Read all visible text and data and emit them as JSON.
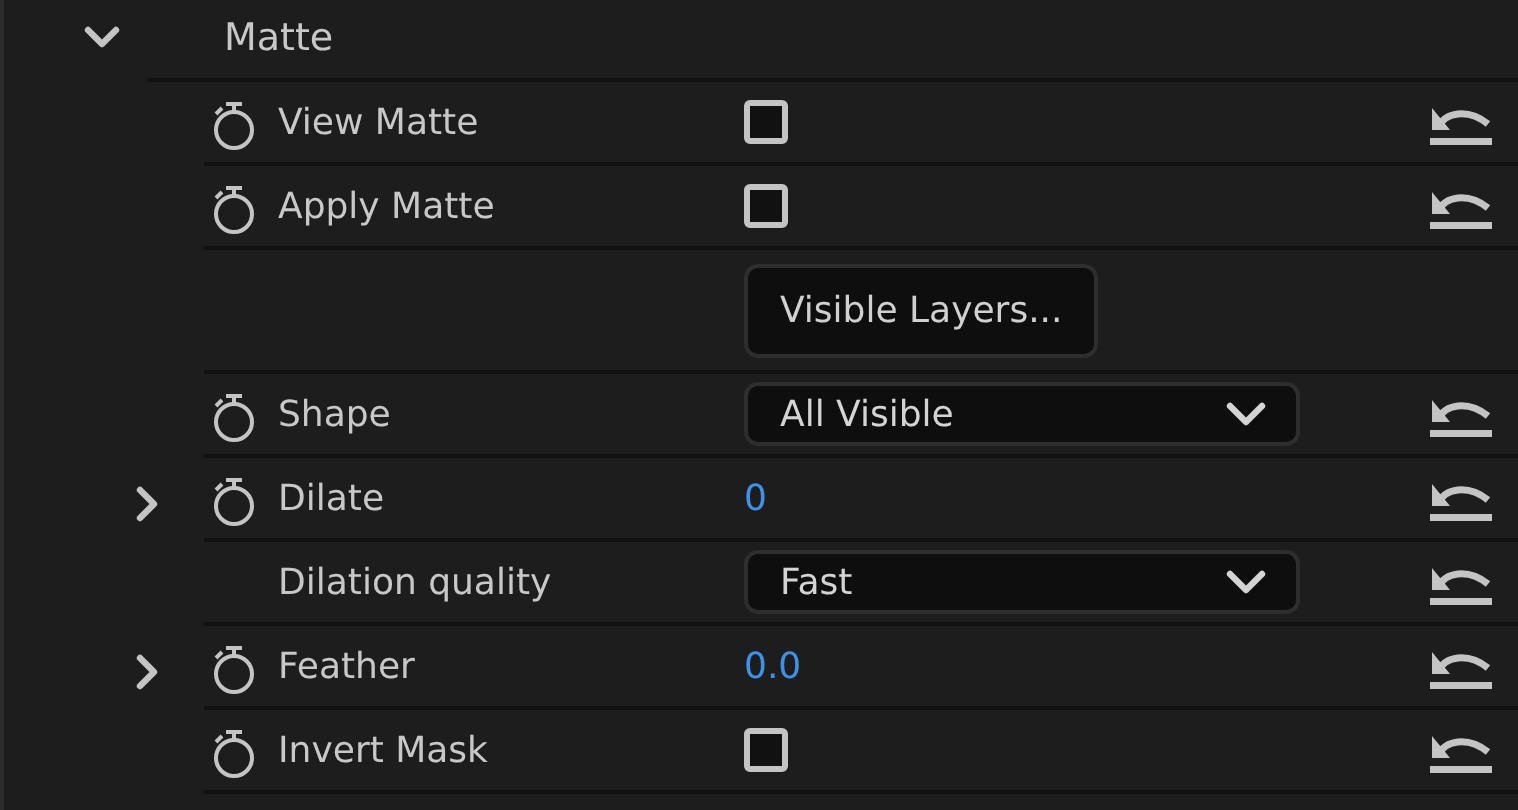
{
  "section": {
    "title": "Matte",
    "expanded": true
  },
  "rows": [
    {
      "kind": "checkbox",
      "label": "View Matte",
      "expandable": false,
      "stopwatch": true,
      "checked": false,
      "resettable": true
    },
    {
      "kind": "checkbox",
      "label": "Apply Matte",
      "expandable": false,
      "stopwatch": true,
      "checked": false,
      "resettable": true
    },
    {
      "kind": "button",
      "button_label": "Visible Layers...",
      "expandable": false,
      "stopwatch": false,
      "resettable": false
    },
    {
      "kind": "dropdown",
      "label": "Shape",
      "value": "All Visible",
      "expandable": false,
      "stopwatch": true,
      "resettable": true
    },
    {
      "kind": "number",
      "label": "Dilate",
      "value": "0",
      "expandable": true,
      "expanded": false,
      "stopwatch": true,
      "resettable": true
    },
    {
      "kind": "dropdown",
      "label": "Dilation quality",
      "value": "Fast",
      "expandable": false,
      "stopwatch": false,
      "resettable": true
    },
    {
      "kind": "number",
      "label": "Feather",
      "value": "0.0",
      "expandable": true,
      "expanded": false,
      "stopwatch": true,
      "resettable": true
    },
    {
      "kind": "checkbox",
      "label": "Invert Mask",
      "expandable": false,
      "stopwatch": true,
      "checked": false,
      "resettable": true
    }
  ]
}
